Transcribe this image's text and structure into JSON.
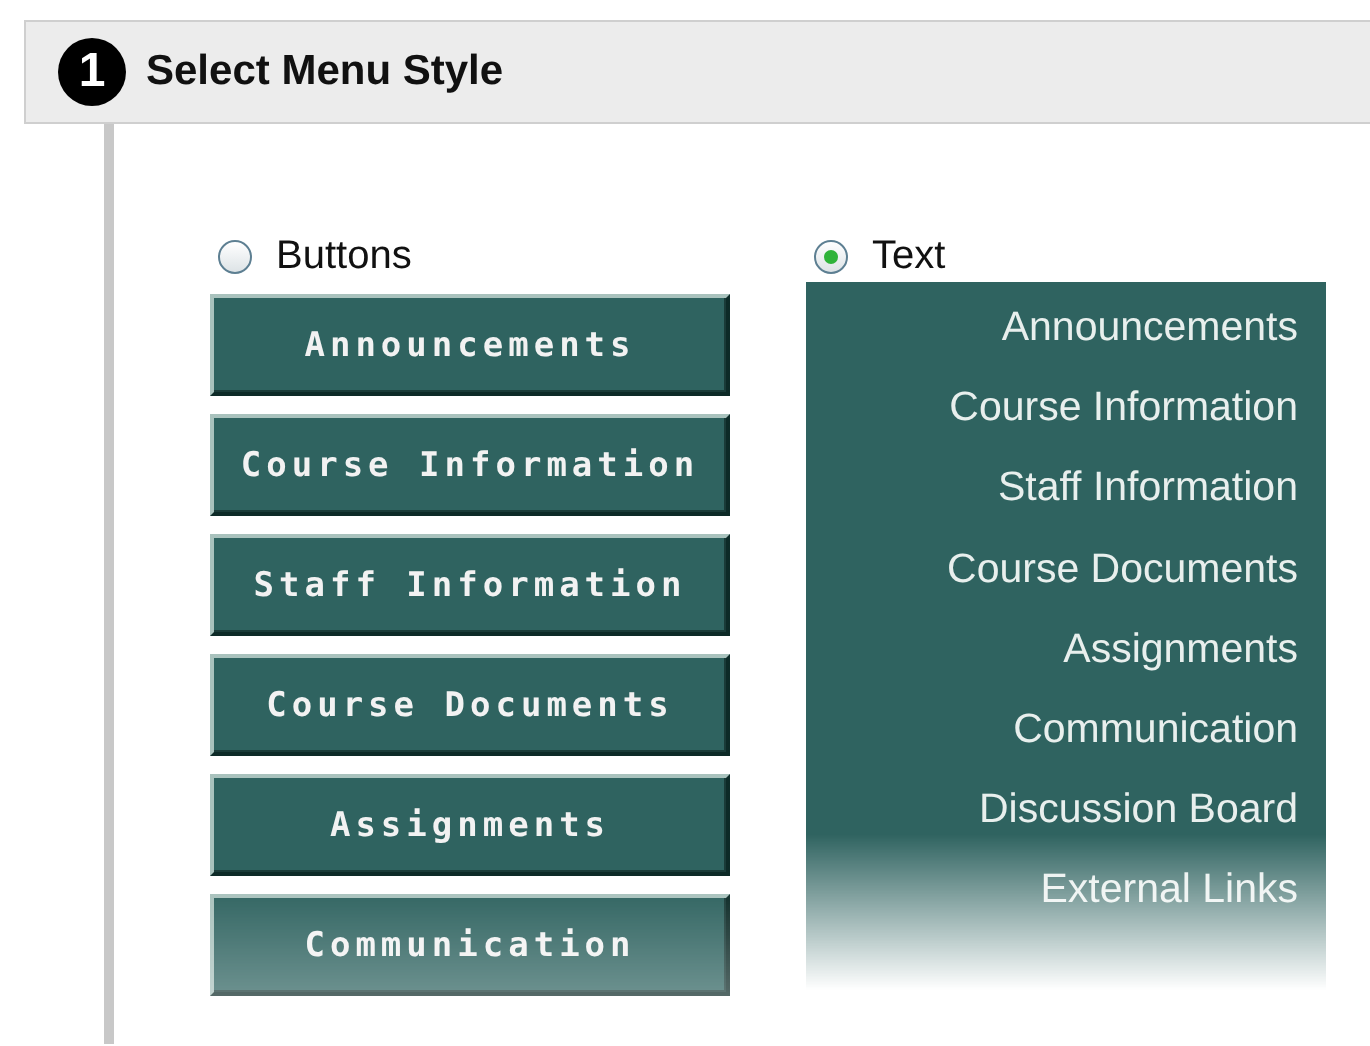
{
  "section": {
    "number": "1",
    "title": "Select Menu Style"
  },
  "options": [
    {
      "kind": "buttons",
      "label": "Buttons",
      "selected": false,
      "items": [
        "Announcements",
        "Course Information",
        "Staff Information",
        "Course Documents",
        "Assignments",
        "Communication"
      ]
    },
    {
      "kind": "text",
      "label": "Text",
      "selected": true,
      "items": [
        "Announcements",
        "Course Information",
        "Staff Information",
        "Course Documents",
        "Assignments",
        "Communication",
        "Discussion Board",
        "External Links"
      ]
    }
  ]
}
